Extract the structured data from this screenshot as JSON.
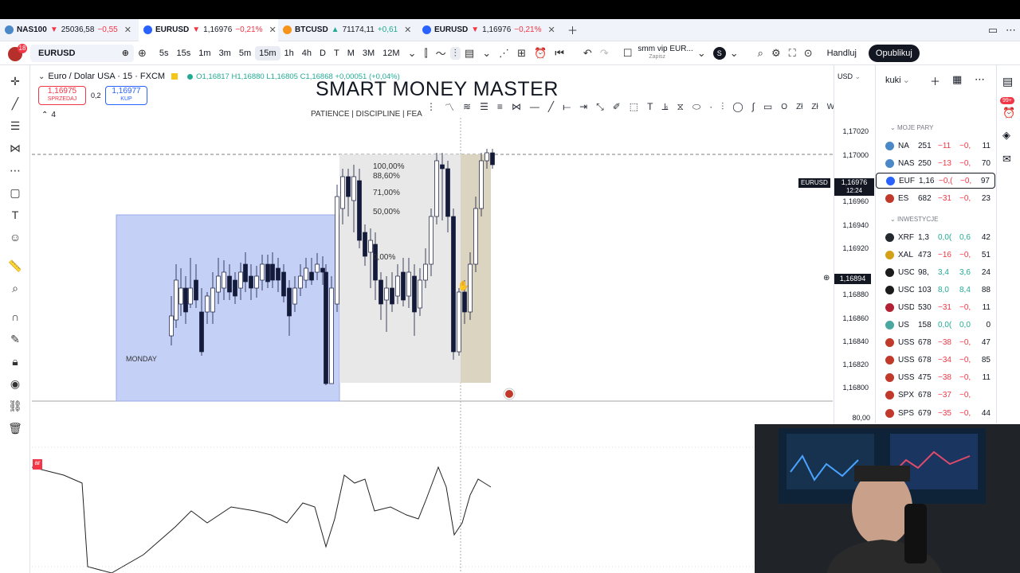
{
  "tabs": [
    {
      "badge": "100",
      "color": "#4b88c7",
      "symbol": "NAS100",
      "arrow": "▼",
      "price": "25036,58",
      "change": "−0,55",
      "dir": "red"
    },
    {
      "badge": "€$",
      "color": "#2962ff",
      "symbol": "EURUSD",
      "arrow": "▼",
      "price": "1,16976",
      "change": "−0,21%",
      "dir": "red"
    },
    {
      "badge": "₿",
      "color": "#f7931a",
      "symbol": "BTCUSD",
      "arrow": "▲",
      "price": "71174,11",
      "change": "+0,61",
      "dir": "green"
    },
    {
      "badge": "€$",
      "color": "#2962ff",
      "symbol": "EURUSD",
      "arrow": "▼",
      "price": "1,16976",
      "change": "−0,21%",
      "dir": "red"
    }
  ],
  "toolbar": {
    "avatar_badge": "18",
    "symbol": "EURUSD",
    "intervals": [
      "5s",
      "15s",
      "1m",
      "3m",
      "5m",
      "15m",
      "1h",
      "4h",
      "D",
      "T",
      "M",
      "3M",
      "12M"
    ],
    "selected_interval": "15m",
    "layout_name": "smm vip EUR...",
    "layout_sub": "Zapisz",
    "profile_initial": "S",
    "trade_label": "Handluj",
    "publish_label": "Opublikuj"
  },
  "legend": {
    "title": "Euro / Dolar USA · 15 · FXCM",
    "ohlc": "O1,16817 H1,16880 L1,16805 C1,16868 +0,00051 (+0,04%)",
    "sell_price": "1,16975",
    "sell_label": "SPRZEDAJ",
    "spread": "0,2",
    "buy_price": "1,16977",
    "buy_label": "KUP",
    "indicators_count": "4"
  },
  "watermark": {
    "title": "SMART MONEY MASTER",
    "subtitle": "PATIENCE | DISCIPLINE | FEA"
  },
  "fib_levels": [
    "100,00%",
    "88,60%",
    "71,00%",
    "50,00%",
    "0,00%"
  ],
  "session_label": "MONDAY",
  "price_scale": {
    "currency": "USD",
    "labels": [
      "1,17020",
      "1,17000",
      "1,16960",
      "1,16940",
      "1,16920",
      "1,16880",
      "1,16860",
      "1,16840",
      "1,16820",
      "1,16800"
    ],
    "last_symbol": "EURUSD",
    "last_price": "1,16976",
    "countdown": "12:24",
    "crosshair_price": "1,16894",
    "indicator_scale": "80,00"
  },
  "watchlist": {
    "name": "kuki",
    "group1": "MOJE PARY",
    "group2": "INWESTYCJE",
    "rows": [
      {
        "sym": "NA",
        "price": "251",
        "chg": "−11",
        "pct": "−0,",
        "vol": "11",
        "dir": "red",
        "color": "#4b88c7",
        "sel": false
      },
      {
        "sym": "NAS",
        "price": "250",
        "chg": "−13",
        "pct": "−0,",
        "vol": "70",
        "dir": "red",
        "color": "#4b88c7",
        "sel": false
      },
      {
        "sym": "EUF",
        "price": "1,16",
        "chg": "−0,(",
        "pct": "−0,",
        "vol": "97",
        "dir": "red",
        "color": "#2962ff",
        "sel": true
      },
      {
        "sym": "ES",
        "price": "682",
        "chg": "−31",
        "pct": "−0,",
        "vol": "23",
        "dir": "red",
        "color": "#c0392b",
        "sel": false
      },
      {
        "sym": "XRF",
        "price": "1,3",
        "chg": "0,0(",
        "pct": "0,6",
        "vol": "42",
        "dir": "green",
        "color": "#23292f",
        "sel": false
      },
      {
        "sym": "XAL",
        "price": "473",
        "chg": "−16",
        "pct": "−0,",
        "vol": "51",
        "dir": "red",
        "color": "#d4a017",
        "sel": false
      },
      {
        "sym": "USC",
        "price": "98,",
        "chg": "3,4",
        "pct": "3,6",
        "vol": "24",
        "dir": "green",
        "color": "#1b1b1b",
        "sel": false
      },
      {
        "sym": "USC",
        "price": "103",
        "chg": "8,0",
        "pct": "8,4",
        "vol": "88",
        "dir": "green",
        "color": "#1b1b1b",
        "sel": false
      },
      {
        "sym": "USD",
        "price": "530",
        "chg": "−31",
        "pct": "−0,",
        "vol": "11",
        "dir": "red",
        "color": "#b22234",
        "sel": false
      },
      {
        "sym": "US",
        "price": "158",
        "chg": "0,0(",
        "pct": "0,0",
        "vol": "0",
        "dir": "green",
        "color": "#4aa8a0",
        "sel": false
      },
      {
        "sym": "USS",
        "price": "678",
        "chg": "−38",
        "pct": "−0,",
        "vol": "47",
        "dir": "red",
        "color": "#c0392b",
        "sel": false
      },
      {
        "sym": "USS",
        "price": "678",
        "chg": "−34",
        "pct": "−0,",
        "vol": "85",
        "dir": "red",
        "color": "#c0392b",
        "sel": false
      },
      {
        "sym": "USS",
        "price": "475",
        "chg": "−38",
        "pct": "−0,",
        "vol": "11",
        "dir": "red",
        "color": "#c0392b",
        "sel": false
      },
      {
        "sym": "SPX",
        "price": "678",
        "chg": "−37",
        "pct": "−0,",
        "vol": "",
        "dir": "red",
        "color": "#c0392b",
        "sel": false
      },
      {
        "sym": "SPS",
        "price": "679",
        "chg": "−35",
        "pct": "−0,",
        "vol": "44",
        "dir": "red",
        "color": "#c0392b",
        "sel": false
      }
    ]
  },
  "notifications_badge": "99+",
  "drawing_toolbar_letters": [
    "O",
    "Zł",
    "Zł",
    "W"
  ],
  "colors": {
    "session_box": "#c5d0f7",
    "fib_box": "#e6e6e6",
    "range_box": "#d8d0b8",
    "bear_candle": "#131a3a",
    "accent": "#2962ff"
  }
}
